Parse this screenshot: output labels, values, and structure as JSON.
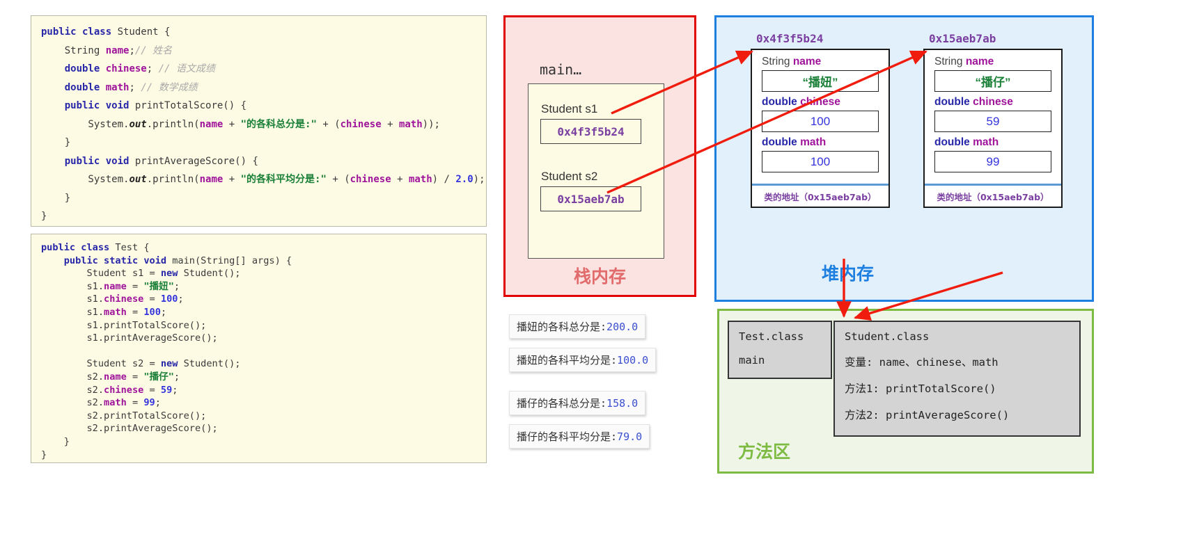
{
  "code_student": {
    "title": "Student.java",
    "lines": [
      [
        [
          "kw",
          "public class "
        ],
        [
          "pl",
          "Student {"
        ]
      ],
      [
        [
          "pl",
          "    String "
        ],
        [
          "fld",
          "name"
        ],
        [
          "pl",
          ";"
        ],
        [
          "cmt",
          "// 姓名"
        ]
      ],
      [
        [
          "pl",
          "    "
        ],
        [
          "kw",
          "double "
        ],
        [
          "fld",
          "chinese"
        ],
        [
          "pl",
          "; "
        ],
        [
          "cmt",
          "// 语文成绩"
        ]
      ],
      [
        [
          "pl",
          "    "
        ],
        [
          "kw",
          "double "
        ],
        [
          "fld",
          "math"
        ],
        [
          "pl",
          "; "
        ],
        [
          "cmt",
          "// 数学成绩"
        ]
      ],
      [
        [
          "pl",
          "    "
        ],
        [
          "kw",
          "public void "
        ],
        [
          "pl",
          "printTotalScore() {"
        ]
      ],
      [
        [
          "pl",
          "        System."
        ],
        [
          "ital",
          "out"
        ],
        [
          "pl",
          ".println("
        ],
        [
          "fld",
          "name"
        ],
        [
          "pl",
          " + "
        ],
        [
          "str",
          "\"的各科总分是:\""
        ],
        [
          "pl",
          " + ("
        ],
        [
          "fld",
          "chinese"
        ],
        [
          "pl",
          " + "
        ],
        [
          "fld",
          "math"
        ],
        [
          "pl",
          "));"
        ]
      ],
      [
        [
          "pl",
          "    }"
        ]
      ],
      [
        [
          "pl",
          "    "
        ],
        [
          "kw",
          "public void "
        ],
        [
          "pl",
          "printAverageScore() {"
        ]
      ],
      [
        [
          "pl",
          "        System."
        ],
        [
          "ital",
          "out"
        ],
        [
          "pl",
          ".println("
        ],
        [
          "fld",
          "name"
        ],
        [
          "pl",
          " + "
        ],
        [
          "str",
          "\"的各科平均分是:\""
        ],
        [
          "pl",
          " + ("
        ],
        [
          "fld",
          "chinese"
        ],
        [
          "pl",
          " + "
        ],
        [
          "fld",
          "math"
        ],
        [
          "pl",
          ") / "
        ],
        [
          "num",
          "2.0"
        ],
        [
          "pl",
          ");"
        ]
      ],
      [
        [
          "pl",
          "    }"
        ]
      ],
      [
        [
          "pl",
          "}"
        ]
      ]
    ]
  },
  "code_test": {
    "title": "Test.java",
    "lines": [
      [
        [
          "kw",
          "public class "
        ],
        [
          "pl",
          "Test {"
        ]
      ],
      [
        [
          "pl",
          "    "
        ],
        [
          "kw",
          "public static void "
        ],
        [
          "pl",
          "main(String[] args) {"
        ]
      ],
      [
        [
          "pl",
          "        Student s1 = "
        ],
        [
          "kw",
          "new "
        ],
        [
          "pl",
          "Student();"
        ]
      ],
      [
        [
          "pl",
          "        s1."
        ],
        [
          "fld",
          "name"
        ],
        [
          "pl",
          " = "
        ],
        [
          "str",
          "\"播妞\""
        ],
        [
          "pl",
          ";"
        ]
      ],
      [
        [
          "pl",
          "        s1."
        ],
        [
          "fld",
          "chinese"
        ],
        [
          "pl",
          " = "
        ],
        [
          "num",
          "100"
        ],
        [
          "pl",
          ";"
        ]
      ],
      [
        [
          "pl",
          "        s1."
        ],
        [
          "fld",
          "math"
        ],
        [
          "pl",
          " = "
        ],
        [
          "num",
          "100"
        ],
        [
          "pl",
          ";"
        ]
      ],
      [
        [
          "pl",
          "        s1.printTotalScore();"
        ]
      ],
      [
        [
          "pl",
          "        s1.printAverageScore();"
        ]
      ],
      [
        [
          "pl",
          ""
        ]
      ],
      [
        [
          "pl",
          "        Student s2 = "
        ],
        [
          "kw",
          "new "
        ],
        [
          "pl",
          "Student();"
        ]
      ],
      [
        [
          "pl",
          "        s2."
        ],
        [
          "fld",
          "name"
        ],
        [
          "pl",
          " = "
        ],
        [
          "str",
          "\"播仔\""
        ],
        [
          "pl",
          ";"
        ]
      ],
      [
        [
          "pl",
          "        s2."
        ],
        [
          "fld",
          "chinese"
        ],
        [
          "pl",
          " = "
        ],
        [
          "num",
          "59"
        ],
        [
          "pl",
          ";"
        ]
      ],
      [
        [
          "pl",
          "        s2."
        ],
        [
          "fld",
          "math"
        ],
        [
          "pl",
          " = "
        ],
        [
          "num",
          "99"
        ],
        [
          "pl",
          ";"
        ]
      ],
      [
        [
          "pl",
          "        s2.printTotalScore();"
        ]
      ],
      [
        [
          "pl",
          "        s2.printAverageScore();"
        ]
      ],
      [
        [
          "pl",
          "    }"
        ]
      ],
      [
        [
          "pl",
          "}"
        ]
      ]
    ]
  },
  "stack": {
    "region_label": "栈内存",
    "frame_title": "main…",
    "vars": [
      {
        "name": "Student  s1",
        "value": "0x4f3f5b24"
      },
      {
        "name": "Student  s2",
        "value": "0x15aeb7ab"
      }
    ],
    "color": "#e00000"
  },
  "heap": {
    "region_label": "堆内存",
    "color": "#1d7fe0",
    "objects": [
      {
        "address": "0x4f3f5b24",
        "fields": [
          {
            "type": "String",
            "type_kw": false,
            "name": "name",
            "value": "“播妞”",
            "kind": "str"
          },
          {
            "type": "double",
            "type_kw": true,
            "name": "chinese",
            "value": "100",
            "kind": "num"
          },
          {
            "type": "double",
            "type_kw": true,
            "name": "math",
            "value": "100",
            "kind": "num"
          }
        ],
        "footer": "类的地址（0x15aeb7ab）"
      },
      {
        "address": "0x15aeb7ab",
        "fields": [
          {
            "type": "String",
            "type_kw": false,
            "name": "name",
            "value": "“播仔”",
            "kind": "str"
          },
          {
            "type": "double",
            "type_kw": true,
            "name": "chinese",
            "value": "59",
            "kind": "num"
          },
          {
            "type": "double",
            "type_kw": true,
            "name": "math",
            "value": "99",
            "kind": "num"
          }
        ],
        "footer": "类的地址（0x15aeb7ab）"
      }
    ]
  },
  "method_area": {
    "region_label": "方法区",
    "color": "#7dbb42",
    "test_class": {
      "title": "Test.class",
      "entries": [
        "main"
      ]
    },
    "student_class": {
      "title": "Student.class",
      "entries": [
        "变量: name、chinese、math",
        "方法1: printTotalScore()",
        "方法2: printAverageScore()"
      ]
    }
  },
  "console_output": [
    {
      "text": "播妞的各科总分是:",
      "num": "200.0"
    },
    {
      "text": "播妞的各科平均分是:",
      "num": "100.0"
    },
    {
      "text": "播仔的各科总分是:",
      "num": "158.0"
    },
    {
      "text": "播仔的各科平均分是:",
      "num": "79.0"
    }
  ],
  "arrow_color": "#f01c0e"
}
